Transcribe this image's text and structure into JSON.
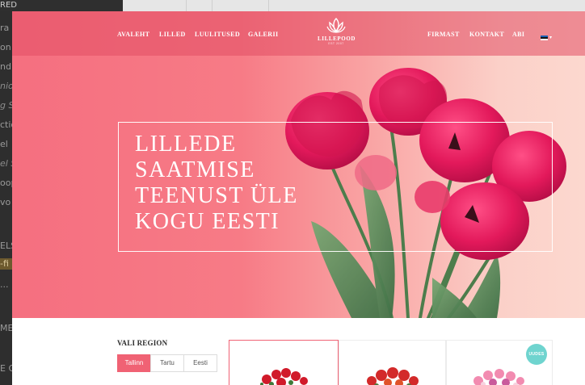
{
  "background_app": {
    "top_left_label": "RED",
    "sidebar_fragments": [
      "ra",
      "on",
      "nd",
      "nio",
      "g S",
      "ctio",
      "el",
      "el S",
      "oop",
      "vo",
      "ELS",
      "-fi",
      "...",
      "ME",
      "E G"
    ]
  },
  "site": {
    "nav_left": [
      "AVALEHT",
      "LILLED",
      "LUULITUSED",
      "GALERII"
    ],
    "nav_right": [
      "FIRMAST",
      "KONTAKT",
      "ABI"
    ],
    "logo_name": "LILLEPOOD",
    "logo_sub": "EST 2007",
    "language_flag": "estonian-flag",
    "hero_headline": [
      "LILLEDE",
      "SAATMISE",
      "TEENUST ÜLE",
      "KOGU EESTI"
    ],
    "region_title": "VALI REGION",
    "region_tabs": [
      "Tallinn",
      "Tartu",
      "Eesti"
    ],
    "active_region": "Tallinn",
    "product_badge": "UUDES"
  },
  "colors": {
    "accent": "#f06274",
    "badge": "#6fd4cf",
    "hero_left": "#f56f80",
    "hero_right": "#fcd8cf"
  }
}
